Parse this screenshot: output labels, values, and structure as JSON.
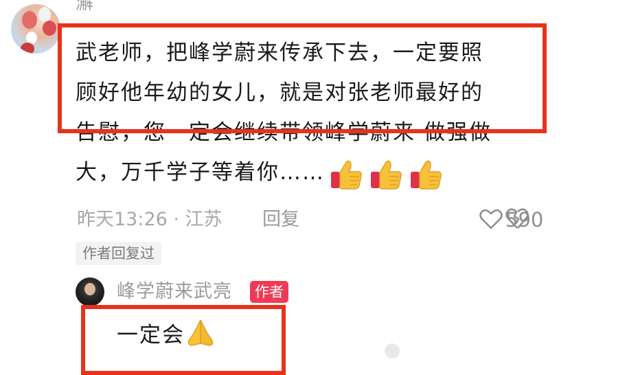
{
  "comment": {
    "username": "澥",
    "lines": [
      "武老师，把峰学蔚来传承下去，一定要照",
      "顾好他年幼的女儿，就是对张老师最好的",
      "告慰，您一定会继续带领峰学蔚来 做强做",
      "大，万千学子等着你……"
    ],
    "emoji_icons": [
      "thumbs-up-icon",
      "thumbs-up-icon",
      "thumbs-up-icon"
    ],
    "time": "昨天13:26 · 江苏",
    "reply_label": "回复",
    "likes": "590",
    "author_replied_label": "作者回复过"
  },
  "reply": {
    "name": "峰学蔚来武亮",
    "badge": "作者",
    "text": "一定会",
    "emoji_icon": "folded-hands-icon"
  },
  "colors": {
    "highlight": "#e8321c",
    "author_badge": "#ef3a57",
    "meta_text": "#a8a8a8"
  }
}
